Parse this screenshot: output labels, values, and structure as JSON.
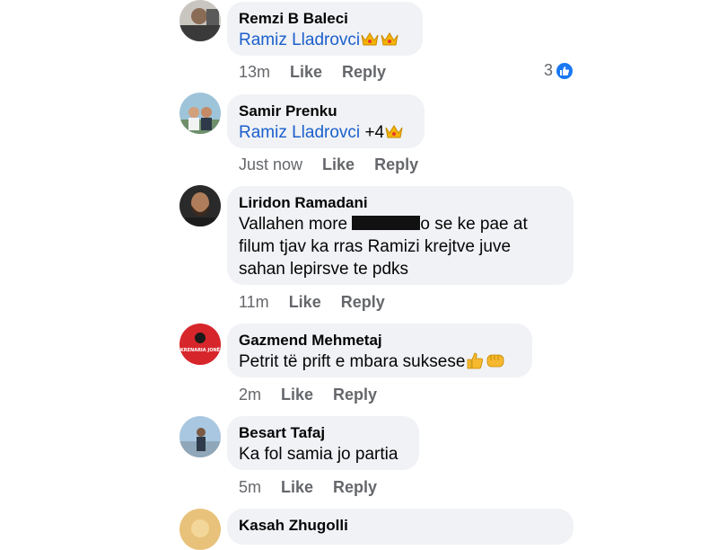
{
  "comments": [
    {
      "author": "Remzi B Baleci",
      "tag": "Ramiz Lladrovci",
      "time": "13m",
      "like": "Like",
      "reply": "Reply",
      "reaction_count": "3"
    },
    {
      "author": "Samir Prenku",
      "tag": "Ramiz Lladrovci",
      "extra": "+4",
      "time": "Just now",
      "like": "Like",
      "reply": "Reply"
    },
    {
      "author": "Liridon Ramadani",
      "line1_a": "Vallahen more",
      "line1_b": "o se ke pae at",
      "line2": "filum tjav ka rras Ramizi krejtve juve",
      "line3": "sahan lepirsve te pdks",
      "time": "11m",
      "like": "Like",
      "reply": "Reply"
    },
    {
      "author": "Gazmend Mehmetaj",
      "avatar_text": "KRENARIA JONË",
      "text": "Petrit të prift e mbara suksese",
      "time": "2m",
      "like": "Like",
      "reply": "Reply"
    },
    {
      "author": "Besart Tafaj",
      "text": "Ka fol samia jo partia",
      "time": "5m",
      "like": "Like",
      "reply": "Reply"
    },
    {
      "author": "Kasah Zhugolli"
    }
  ],
  "colors": {
    "bubble": "#f0f2f5",
    "tag": "#1b5fcc",
    "meta": "#65676b",
    "like_badge": "#1877f2"
  }
}
